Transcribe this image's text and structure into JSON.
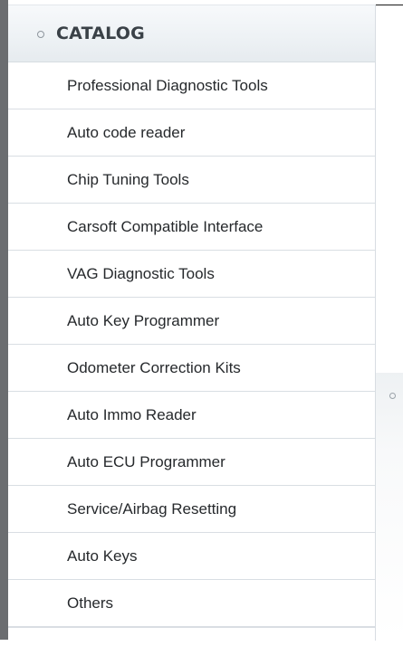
{
  "catalog": {
    "title": "CATALOG",
    "items": [
      {
        "label": "Professional Diagnostic Tools"
      },
      {
        "label": "Auto code reader"
      },
      {
        "label": "Chip Tuning Tools"
      },
      {
        "label": "Carsoft Compatible Interface"
      },
      {
        "label": "VAG Diagnostic Tools"
      },
      {
        "label": "Auto Key Programmer"
      },
      {
        "label": "Odometer Correction Kits"
      },
      {
        "label": "Auto Immo Reader"
      },
      {
        "label": "Auto ECU Programmer"
      },
      {
        "label": "Service/Airbag Resetting"
      },
      {
        "label": "Auto Keys"
      },
      {
        "label": "Others"
      }
    ]
  },
  "colors": {
    "left_bar": "#6b6d70",
    "header_bg": "#eef2f5",
    "item_text": "#26292c",
    "divider": "#d9dee3"
  },
  "icons": {
    "header_bullet": "ring-bullet-icon",
    "side_bullet": "ring-bullet-icon"
  }
}
